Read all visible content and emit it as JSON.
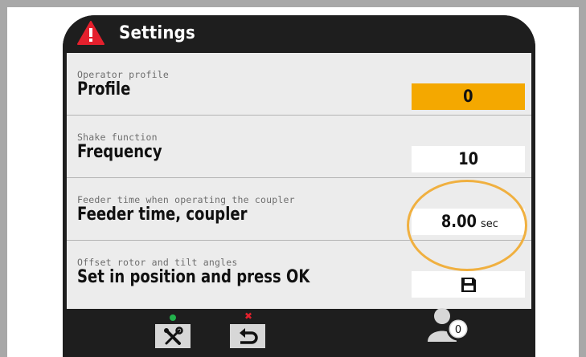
{
  "header": {
    "title": "Settings",
    "icon": "warning-icon"
  },
  "settings": [
    {
      "description": "Operator profile",
      "label": "Profile",
      "value": "0",
      "unit": "",
      "active": true
    },
    {
      "description": "Shake function",
      "label": "Frequency",
      "value": "10",
      "unit": "",
      "active": false
    },
    {
      "description": "Feeder time when operating the coupler",
      "label": "Feeder time, coupler",
      "value": "8.00",
      "unit": "sec",
      "active": false
    },
    {
      "description": "Offset rotor and tilt angles",
      "label": "Set in position and press OK",
      "value_icon": "save-icon",
      "active": false
    }
  ],
  "footer": {
    "softkeys": [
      {
        "icon": "tools-icon",
        "indicator": "green-dot"
      },
      {
        "icon": "back-arrow-icon",
        "indicator": "red-cross"
      }
    ],
    "operator_badge": "0",
    "operator_icon": "operator-profile-icon"
  },
  "colors": {
    "accent": "#f4a800",
    "highlight_ring": "#f0b040",
    "screen_dark": "#1e1e1e",
    "panel_bg": "#ececec",
    "indicator_green": "#22b24c",
    "indicator_red": "#e4202d"
  }
}
